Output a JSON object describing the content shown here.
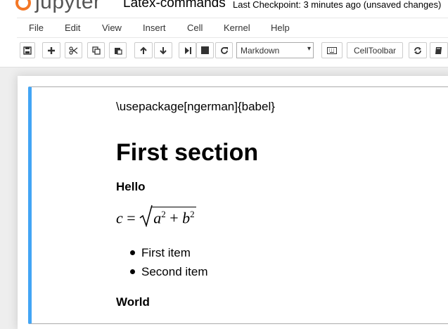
{
  "header": {
    "logo_text": "jupyter",
    "notebook_title": "Latex-commands",
    "checkpoint_status": "Last Checkpoint: 3 minutes ago (unsaved changes)"
  },
  "menu": {
    "items": [
      "File",
      "Edit",
      "View",
      "Insert",
      "Cell",
      "Kernel",
      "Help"
    ]
  },
  "toolbar": {
    "cell_type_selected": "Markdown",
    "celltoolbar_label": "CellToolbar",
    "icons": [
      "save-icon",
      "plus-icon",
      "cut-icon",
      "copy-icon",
      "paste-icon",
      "arrow-up-icon",
      "arrow-down-icon",
      "step-forward-icon",
      "stop-icon",
      "restart-icon",
      "keyboard-icon",
      "refresh-icon",
      "book-icon"
    ]
  },
  "cell": {
    "command_text": "\\usepackage[ngerman]{babel}",
    "heading": "First section",
    "subheading_1": "Hello",
    "math": {
      "lhs": "c",
      "equals": "=",
      "a": "a",
      "b": "b",
      "plus": "+",
      "exp_a": "2",
      "exp_b": "2"
    },
    "bullets": [
      "First item",
      "Second item"
    ],
    "subheading_2": "World"
  },
  "colors": {
    "cell_active_border": "#42a5f5",
    "logo_orange": "#f37726"
  }
}
